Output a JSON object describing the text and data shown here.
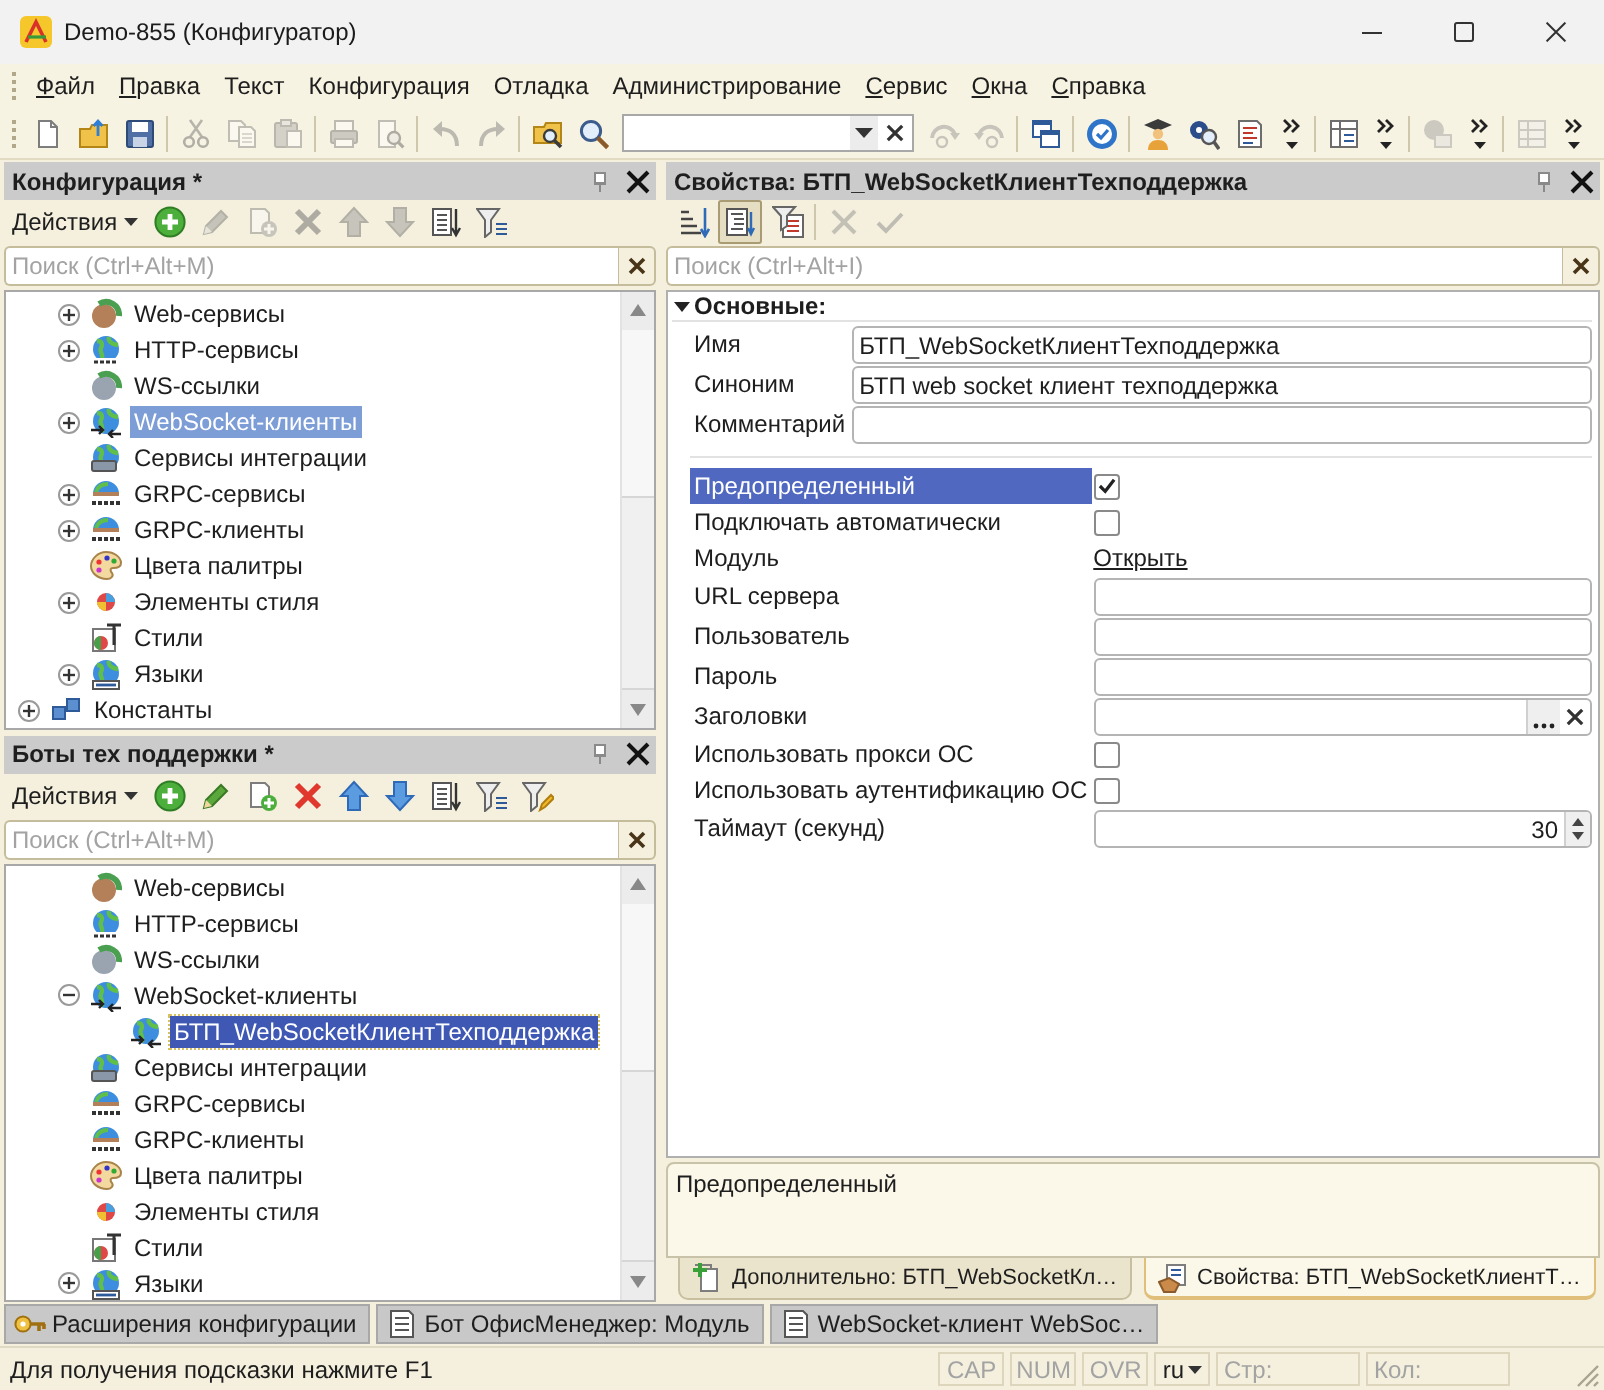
{
  "window": {
    "title": "Demo-855 (Конфигуратор)"
  },
  "menu": [
    {
      "label": "Файл",
      "mnemonic": true
    },
    {
      "label": "Правка",
      "mnemonic": true
    },
    {
      "label": "Текст",
      "mnemonic": false
    },
    {
      "label": "Конфигурация",
      "mnemonic": false
    },
    {
      "label": "Отладка",
      "mnemonic": false
    },
    {
      "label": "Администрирование",
      "mnemonic": false
    },
    {
      "label": "Сервис",
      "mnemonic": true
    },
    {
      "label": "Окна",
      "mnemonic": true
    },
    {
      "label": "Справка",
      "mnemonic": true
    }
  ],
  "toolbar": {
    "groups": [
      {
        "buttons": [
          {
            "kind": "new",
            "disabled": false
          },
          {
            "kind": "open",
            "disabled": false
          },
          {
            "kind": "save",
            "disabled": false
          }
        ]
      },
      {
        "buttons": [
          {
            "kind": "cut",
            "disabled": true
          },
          {
            "kind": "copy",
            "disabled": true
          },
          {
            "kind": "paste",
            "disabled": true
          }
        ]
      },
      {
        "buttons": [
          {
            "kind": "print",
            "disabled": true
          },
          {
            "kind": "preview",
            "disabled": true
          }
        ]
      },
      {
        "buttons": [
          {
            "kind": "undo",
            "disabled": true
          },
          {
            "kind": "redo",
            "disabled": true
          }
        ]
      },
      {
        "buttons": [
          {
            "kind": "findfolder",
            "disabled": false
          },
          {
            "kind": "search",
            "disabled": false
          },
          {
            "kind": "combo",
            "disabled": false
          },
          {
            "kind": "findnext",
            "disabled": true
          },
          {
            "kind": "findprev",
            "disabled": true
          }
        ]
      },
      {
        "buttons": [
          {
            "kind": "windows",
            "disabled": false
          }
        ]
      },
      {
        "buttons": [
          {
            "kind": "verify",
            "disabled": false
          }
        ]
      },
      {
        "buttons": [
          {
            "kind": "teacher",
            "disabled": false
          },
          {
            "kind": "helpsearch",
            "disabled": false
          },
          {
            "kind": "syntax",
            "disabled": false
          },
          {
            "kind": "overflow",
            "disabled": false
          }
        ]
      },
      {
        "buttons": [
          {
            "kind": "table",
            "disabled": false
          },
          {
            "kind": "overflow",
            "disabled": false
          }
        ]
      },
      {
        "buttons": [
          {
            "kind": "addobject",
            "disabled": true
          },
          {
            "kind": "overflow",
            "disabled": false
          }
        ]
      },
      {
        "buttons": [
          {
            "kind": "grid",
            "disabled": true
          },
          {
            "kind": "overflow",
            "disabled": false
          }
        ]
      }
    ]
  },
  "panels": [
    {
      "title": "Конфигурация *",
      "focused": false,
      "actions_label": "Действия",
      "buttons": [
        {
          "kind": "add",
          "disabled": false
        },
        {
          "kind": "edit",
          "disabled": true
        },
        {
          "kind": "docadd",
          "disabled": true
        },
        {
          "kind": "delete",
          "disabled": true
        },
        {
          "kind": "up",
          "disabled": true
        },
        {
          "kind": "down",
          "disabled": true
        },
        {
          "kind": "sortlist",
          "disabled": false
        },
        {
          "kind": "filter",
          "disabled": false
        }
      ],
      "search": {
        "placeholder": "Поиск (Ctrl+Alt+M)"
      },
      "tree": [
        {
          "children": [
            {
              "label": "Web-сервисы",
              "kind": "webservice",
              "expandable": true,
              "expanded": false,
              "selected": false
            },
            {
              "label": "HTTP-сервисы",
              "kind": "http",
              "expandable": true,
              "expanded": false,
              "selected": false
            },
            {
              "label": "WS-ссылки",
              "kind": "wslink",
              "expandable": false,
              "selected": false
            },
            {
              "label": "WebSocket-клиенты",
              "kind": "websocket",
              "expandable": true,
              "expanded": false,
              "selected": true
            },
            {
              "label": "Сервисы интеграции",
              "kind": "integration",
              "expandable": false,
              "selected": false
            },
            {
              "label": "GRPC-сервисы",
              "kind": "grpc",
              "expandable": true,
              "expanded": false,
              "selected": false
            },
            {
              "label": "GRPC-клиенты",
              "kind": "grpc",
              "expandable": true,
              "expanded": false,
              "selected": false
            },
            {
              "label": "Цвета палитры",
              "kind": "palette",
              "expandable": false,
              "selected": false
            },
            {
              "label": "Элементы стиля",
              "kind": "styleitem",
              "expandable": true,
              "expanded": false,
              "selected": false
            },
            {
              "label": "Стили",
              "kind": "style",
              "expandable": false,
              "selected": false
            },
            {
              "label": "Языки",
              "kind": "language",
              "expandable": true,
              "expanded": false,
              "selected": false
            }
          ]
        },
        {
          "label": "Константы",
          "kind": "constant",
          "expandable": true,
          "expanded": false,
          "selected": false
        }
      ]
    },
    {
      "title": "Боты тех поддержки *",
      "focused": true,
      "actions_label": "Действия",
      "buttons": [
        {
          "kind": "add",
          "disabled": false
        },
        {
          "kind": "edit",
          "disabled": false
        },
        {
          "kind": "docadd",
          "disabled": false
        },
        {
          "kind": "delete",
          "disabled": false
        },
        {
          "kind": "up",
          "disabled": false
        },
        {
          "kind": "down",
          "disabled": false
        },
        {
          "kind": "sortlist",
          "disabled": false
        },
        {
          "kind": "filter",
          "disabled": false
        },
        {
          "kind": "filteredit",
          "disabled": false
        }
      ],
      "search": {
        "placeholder": "Поиск (Ctrl+Alt+M)"
      },
      "tree": [
        {
          "children": [
            {
              "label": "Web-сервисы",
              "kind": "webservice",
              "expandable": false,
              "selected": false
            },
            {
              "label": "HTTP-сервисы",
              "kind": "http",
              "expandable": false,
              "selected": false
            },
            {
              "label": "WS-ссылки",
              "kind": "wslink",
              "expandable": false,
              "selected": false
            },
            {
              "label": "WebSocket-клиенты",
              "kind": "websocket",
              "expandable": true,
              "expanded": true,
              "selected": false,
              "children": [
                {
                  "label": "БТП_WebSocketКлиентТехподдержка",
                  "kind": "websocket",
                  "expandable": false,
                  "selected": true
                }
              ]
            },
            {
              "label": "Сервисы интеграции",
              "kind": "integration",
              "expandable": false,
              "selected": false
            },
            {
              "label": "GRPC-сервисы",
              "kind": "grpc",
              "expandable": false,
              "selected": false
            },
            {
              "label": "GRPC-клиенты",
              "kind": "grpc",
              "expandable": false,
              "selected": false
            },
            {
              "label": "Цвета палитры",
              "kind": "palette",
              "expandable": false,
              "selected": false
            },
            {
              "label": "Элементы стиля",
              "kind": "styleitem",
              "expandable": false,
              "selected": false
            },
            {
              "label": "Стили",
              "kind": "style",
              "expandable": false,
              "selected": false
            },
            {
              "label": "Языки",
              "kind": "language",
              "expandable": true,
              "expanded": false,
              "selected": false
            }
          ]
        }
      ]
    }
  ],
  "properties": {
    "title": "Свойства: БТП_WebSocketКлиентТехподдержка",
    "button_groups": [
      [
        {
          "kind": "sortaz",
          "pressed": false,
          "disabled": false
        },
        {
          "kind": "categories",
          "pressed": true,
          "disabled": false
        },
        {
          "kind": "filterdoc",
          "pressed": false,
          "disabled": false
        }
      ],
      [
        {
          "kind": "cancel",
          "pressed": false,
          "disabled": true
        },
        {
          "kind": "apply",
          "pressed": false,
          "disabled": true
        }
      ]
    ],
    "search": {
      "placeholder": "Поиск (Ctrl+Alt+I)"
    },
    "section": {
      "title": "Основные:",
      "expanded": true
    },
    "groups": [
      [
        {
          "label": "Имя",
          "kind": "text",
          "value": "БТП_WebSocketКлиентТехподдержка",
          "selected": false
        },
        {
          "label": "Синоним",
          "kind": "text",
          "value": "БТП web socket клиент техподдержка",
          "selected": false
        },
        {
          "label": "Комментарий",
          "kind": "text",
          "selected": false
        }
      ],
      [
        {
          "label": "Предопределенный",
          "kind": "checkbox",
          "checked": true,
          "selected": true
        },
        {
          "label": "Подключать автоматически",
          "kind": "checkbox",
          "checked": false,
          "selected": false
        },
        {
          "label": "Модуль",
          "kind": "link",
          "link": "Открыть",
          "selected": false
        },
        {
          "label": "URL сервера",
          "kind": "text",
          "selected": false
        },
        {
          "label": "Пользователь",
          "kind": "text",
          "selected": false
        },
        {
          "label": "Пароль",
          "kind": "text",
          "selected": false
        },
        {
          "label": "Заголовки",
          "kind": "choice",
          "selected": false
        },
        {
          "label": "Использовать прокси ОС",
          "kind": "checkbox",
          "checked": false,
          "selected": false
        },
        {
          "label": "Использовать аутентификацию ОС",
          "kind": "checkbox",
          "checked": false,
          "selected": false
        },
        {
          "label": "Таймаут (секунд)",
          "kind": "number",
          "value": "30",
          "selected": false
        }
      ]
    ],
    "description": "Предопределенный",
    "tabs": [
      {
        "label": "Дополнительно: БТП_WebSocketКл…",
        "kind": "extra",
        "selected": false
      },
      {
        "label": "Свойства: БТП_WebSocketКлиентТ…",
        "kind": "props",
        "selected": true
      }
    ]
  },
  "window_tabs": [
    {
      "label": "Расширения конфигурации",
      "kind": "extension"
    },
    {
      "label": "Бот ОфисМенеджер: Модуль",
      "kind": "module"
    },
    {
      "label": "WebSocket-клиент WebSoc…",
      "kind": "module"
    }
  ],
  "status_bar": {
    "hint": "Для получения подсказки нажмите F1",
    "indicators": [
      {
        "label": "CAP",
        "on": false
      },
      {
        "label": "NUM",
        "on": false
      },
      {
        "label": "OVR",
        "on": false
      }
    ],
    "language": "ru",
    "line_label": "Стр:",
    "column_label": "Кол:"
  }
}
